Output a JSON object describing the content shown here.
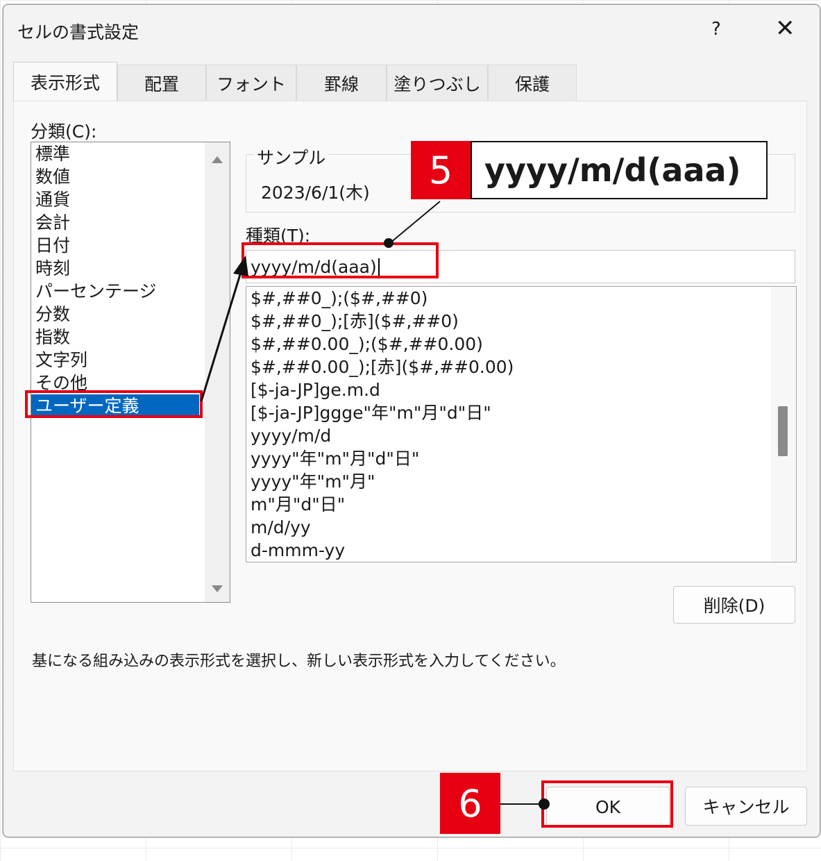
{
  "dialog": {
    "title": "セルの書式設定",
    "help": "?",
    "close": "✕"
  },
  "tabs": [
    {
      "label": "表示形式"
    },
    {
      "label": "配置"
    },
    {
      "label": "フォント"
    },
    {
      "label": "罫線"
    },
    {
      "label": "塗りつぶし"
    },
    {
      "label": "保護"
    }
  ],
  "category": {
    "label": "分類(C):",
    "items": [
      "標準",
      "数値",
      "通貨",
      "会計",
      "日付",
      "時刻",
      "パーセンテージ",
      "分数",
      "指数",
      "文字列",
      "その他",
      "ユーザー定義"
    ],
    "selected": "ユーザー定義"
  },
  "sample": {
    "label": "サンプル",
    "value": "2023/6/1(木)"
  },
  "type": {
    "label": "種類(T):",
    "value": "yyyy/m/d(aaa)",
    "formats": [
      "$#,##0_);($#,##0)",
      "$#,##0_);[赤]($#,##0)",
      "$#,##0.00_);($#,##0.00)",
      "$#,##0.00_);[赤]($#,##0.00)",
      "[$-ja-JP]ge.m.d",
      "[$-ja-JP]ggge\"年\"m\"月\"d\"日\"",
      "yyyy/m/d",
      "yyyy\"年\"m\"月\"d\"日\"",
      "yyyy\"年\"m\"月\"",
      "m\"月\"d\"日\"",
      "m/d/yy",
      "d-mmm-yy"
    ]
  },
  "buttons": {
    "delete": "削除(D)",
    "ok": "OK",
    "cancel": "キャンセル"
  },
  "description": "基になる組み込みの表示形式を選択し、新しい表示形式を入力してください。",
  "annotations": {
    "step5": {
      "badge": "5",
      "text": "yyyy/m/d(aaa)"
    },
    "step6": {
      "badge": "6"
    },
    "highlight_color": "#e60012"
  }
}
